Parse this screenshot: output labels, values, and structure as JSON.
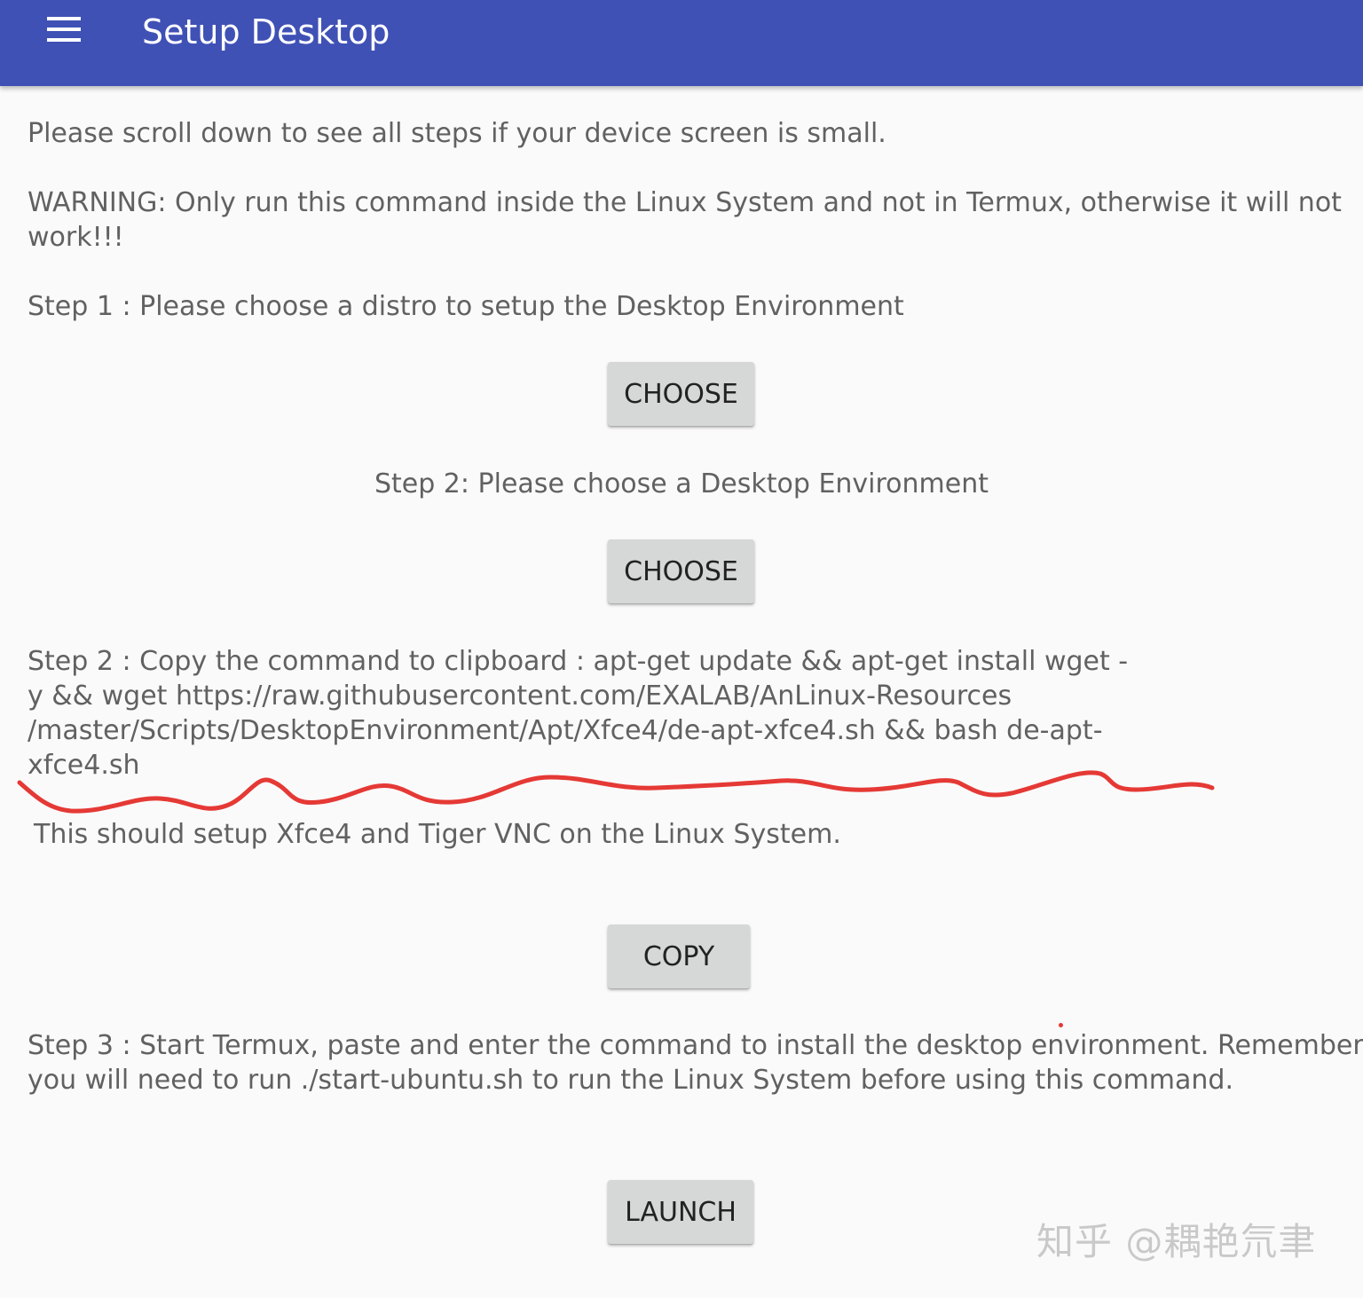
{
  "appbar": {
    "title": "Setup Desktop",
    "menu_icon": "menu-icon"
  },
  "content": {
    "scroll_hint": "Please scroll down to see all steps if your device screen is small.",
    "warning_line1": "WARNING: Only run this command inside the Linux System and not in Termux, otherwise it will not",
    "warning_line2": "work!!!",
    "step1_text": "Step 1 : Please choose a distro to setup the Desktop Environment",
    "step1_button": "CHOOSE",
    "step2_text": "Step 2: Please choose a Desktop Environment",
    "step2_button": "CHOOSE",
    "command_line1": "Step 2 : Copy the command to clipboard : apt-get update && apt-get install wget -",
    "command_line2": "y && wget https://raw.githubusercontent.com/EXALAB/AnLinux-Resources",
    "command_line3": "/master/Scripts/DesktopEnvironment/Apt/Xfce4/de-apt-xfce4.sh && bash de-apt-",
    "command_line4": "xfce4.sh",
    "result_text": "This should setup Xfce4 and Tiger VNC on the Linux System.",
    "copy_button": "COPY",
    "step3_line1": "Step 3 : Start Termux, paste and enter the command to install the desktop environment. Remember:",
    "step3_line2": "you will need to run ./start-ubuntu.sh to run the Linux System before using this command.",
    "launch_button": "LAUNCH"
  },
  "watermark": "知乎 @耦艳氘聿",
  "colors": {
    "appbar": "#3f51b5",
    "background": "#fafafa",
    "body_text": "#616161",
    "button_bg": "#d6d7d7",
    "annotation": "#e53935"
  }
}
